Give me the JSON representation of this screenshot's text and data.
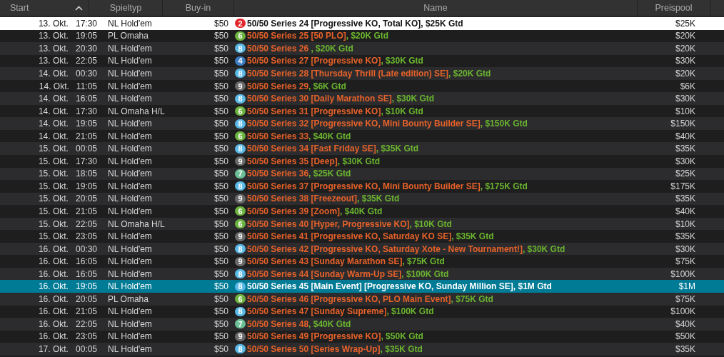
{
  "table": {
    "columns": [
      {
        "label": "Start",
        "sorted": true
      },
      {
        "label": "Spieltyp",
        "sorted": false
      },
      {
        "label": "Buy-in",
        "sorted": false
      },
      {
        "label": "Name",
        "sorted": false
      },
      {
        "label": "Preispool",
        "sorted": false
      }
    ],
    "rows": [
      {
        "date": "13. Okt.",
        "time": "17:30",
        "game": "NL Hold'em",
        "buyin": "$50",
        "badge": {
          "text": "2",
          "color": "#e3262b"
        },
        "title": "50/50 Series 24 [Progressive KO, Total KO]",
        "guarantee": ", $25K Gtd",
        "prize": "$25K",
        "highlighted": true,
        "selected": false
      },
      {
        "date": "13. Okt.",
        "time": "19:05",
        "game": "PL Omaha",
        "buyin": "$50",
        "badge": {
          "text": "6",
          "color": "#6cb33f"
        },
        "title": "50/50 Series 25 [50 PLO]",
        "guarantee": ", $20K Gtd",
        "prize": "$20K",
        "highlighted": false,
        "selected": false
      },
      {
        "date": "13. Okt.",
        "time": "20:30",
        "game": "NL Hold'em",
        "buyin": "$50",
        "badge": {
          "text": "8",
          "color": "#5ab9e6"
        },
        "title": "50/50 Series 26 ",
        "guarantee": ", $20K Gtd",
        "prize": "$20K",
        "highlighted": false,
        "selected": false
      },
      {
        "date": "13. Okt.",
        "time": "22:05",
        "game": "NL Hold'em",
        "buyin": "$50",
        "badge": {
          "text": "4",
          "color": "#3c7cc2"
        },
        "title": "50/50 Series 27 [Progressive KO]",
        "guarantee": ", $30K Gtd",
        "prize": "$30K",
        "highlighted": false,
        "selected": false
      },
      {
        "date": "14. Okt.",
        "time": "00:30",
        "game": "NL Hold'em",
        "buyin": "$50",
        "badge": {
          "text": "8",
          "color": "#5ab9e6"
        },
        "title": "50/50 Series 28 [Thursday Thrill (Late edition) SE]",
        "guarantee": ", $20K Gtd",
        "prize": "$20K",
        "highlighted": false,
        "selected": false
      },
      {
        "date": "14. Okt.",
        "time": "11:05",
        "game": "NL Hold'em",
        "buyin": "$50",
        "badge": {
          "text": "9",
          "color": "#6a6a6a"
        },
        "title": "50/50 Series 29",
        "guarantee": ", $6K Gtd",
        "prize": "$6K",
        "highlighted": false,
        "selected": false
      },
      {
        "date": "14. Okt.",
        "time": "16:05",
        "game": "NL Hold'em",
        "buyin": "$50",
        "badge": {
          "text": "8",
          "color": "#5ab9e6"
        },
        "title": "50/50 Series 30 [Daily Marathon SE]",
        "guarantee": ", $30K Gtd",
        "prize": "$30K",
        "highlighted": false,
        "selected": false
      },
      {
        "date": "14. Okt.",
        "time": "17:30",
        "game": "NL Omaha H/L",
        "buyin": "$50",
        "badge": {
          "text": "6",
          "color": "#6cb33f"
        },
        "title": "50/50 Series 31 [Progressive KO]",
        "guarantee": ", $10K Gtd",
        "prize": "$10K",
        "highlighted": false,
        "selected": false
      },
      {
        "date": "14. Okt.",
        "time": "19:05",
        "game": "NL Hold'em",
        "buyin": "$50",
        "badge": {
          "text": "8",
          "color": "#5ab9e6"
        },
        "title": "50/50 Series 32 [Progressive KO, Mini Bounty Builder SE]",
        "guarantee": ", $150K Gtd",
        "prize": "$150K",
        "highlighted": false,
        "selected": false
      },
      {
        "date": "14. Okt.",
        "time": "21:05",
        "game": "NL Hold'em",
        "buyin": "$50",
        "badge": {
          "text": "6",
          "color": "#6cb33f"
        },
        "title": "50/50 Series 33",
        "guarantee": ", $40K Gtd",
        "prize": "$40K",
        "highlighted": false,
        "selected": false
      },
      {
        "date": "15. Okt.",
        "time": "00:05",
        "game": "NL Hold'em",
        "buyin": "$50",
        "badge": {
          "text": "8",
          "color": "#5ab9e6"
        },
        "title": "50/50 Series 34 [Fast Friday SE]",
        "guarantee": ", $35K Gtd",
        "prize": "$35K",
        "highlighted": false,
        "selected": false
      },
      {
        "date": "15. Okt.",
        "time": "17:30",
        "game": "NL Hold'em",
        "buyin": "$50",
        "badge": {
          "text": "9",
          "color": "#6a6a6a"
        },
        "title": "50/50 Series 35 [Deep]",
        "guarantee": ", $30K Gtd",
        "prize": "$30K",
        "highlighted": false,
        "selected": false
      },
      {
        "date": "15. Okt.",
        "time": "18:05",
        "game": "NL Hold'em",
        "buyin": "$50",
        "badge": {
          "text": "7",
          "color": "#6dbf97"
        },
        "title": "50/50 Series 36",
        "guarantee": ", $25K Gtd",
        "prize": "$25K",
        "highlighted": false,
        "selected": false
      },
      {
        "date": "15. Okt.",
        "time": "19:05",
        "game": "NL Hold'em",
        "buyin": "$50",
        "badge": {
          "text": "8",
          "color": "#5ab9e6"
        },
        "title": "50/50 Series 37 [Progressive KO, Mini Bounty Builder SE]",
        "guarantee": ", $175K Gtd",
        "prize": "$175K",
        "highlighted": false,
        "selected": false
      },
      {
        "date": "15. Okt.",
        "time": "20:05",
        "game": "NL Hold'em",
        "buyin": "$50",
        "badge": {
          "text": "9",
          "color": "#6a6a6a"
        },
        "title": "50/50 Series 38 [Freezeout]",
        "guarantee": ", $35K Gtd",
        "prize": "$35K",
        "highlighted": false,
        "selected": false
      },
      {
        "date": "15. Okt.",
        "time": "21:05",
        "game": "NL Hold'em",
        "buyin": "$50",
        "badge": {
          "text": "6",
          "color": "#6cb33f"
        },
        "title": "50/50 Series 39 [Zoom]",
        "guarantee": ", $40K Gtd",
        "prize": "$40K",
        "highlighted": false,
        "selected": false
      },
      {
        "date": "15. Okt.",
        "time": "22:05",
        "game": "NL Omaha H/L",
        "buyin": "$50",
        "badge": {
          "text": "6",
          "color": "#6cb33f"
        },
        "title": "50/50 Series 40 [Hyper, Progressive KO]",
        "guarantee": ", $10K Gtd",
        "prize": "$10K",
        "highlighted": false,
        "selected": false
      },
      {
        "date": "15. Okt.",
        "time": "23:05",
        "game": "NL Hold'em",
        "buyin": "$50",
        "badge": {
          "text": "9",
          "color": "#6a6a6a"
        },
        "title": "50/50 Series 41 [Progressive KO, Saturday KO SE]",
        "guarantee": ", $35K Gtd",
        "prize": "$35K",
        "highlighted": false,
        "selected": false
      },
      {
        "date": "16. Okt.",
        "time": "00:30",
        "game": "NL Hold'em",
        "buyin": "$50",
        "badge": {
          "text": "8",
          "color": "#5ab9e6"
        },
        "title": "50/50 Series 42 [Progressive KO, Saturday Xote - New Tournament!]",
        "guarantee": ", $30K Gtd",
        "prize": "$30K",
        "highlighted": false,
        "selected": false
      },
      {
        "date": "16. Okt.",
        "time": "16:05",
        "game": "NL Hold'em",
        "buyin": "$50",
        "badge": {
          "text": "9",
          "color": "#6a6a6a"
        },
        "title": "50/50 Series 43 [Sunday Marathon SE]",
        "guarantee": ", $75K Gtd",
        "prize": "$75K",
        "highlighted": false,
        "selected": false
      },
      {
        "date": "16. Okt.",
        "time": "16:05",
        "game": "NL Hold'em",
        "buyin": "$50",
        "badge": {
          "text": "8",
          "color": "#5ab9e6"
        },
        "title": "50/50 Series 44 [Sunday Warm-Up SE]",
        "guarantee": ", $100K Gtd",
        "prize": "$100K",
        "highlighted": false,
        "selected": false
      },
      {
        "date": "16. Okt.",
        "time": "19:05",
        "game": "NL Hold'em",
        "buyin": "$50",
        "badge": {
          "text": "8",
          "color": "#5ab9e6"
        },
        "title": "50/50 Series 45 [Main Event] [Progressive KO, Sunday Million SE]",
        "guarantee": ", $1M Gtd",
        "prize": "$1M",
        "highlighted": false,
        "selected": true
      },
      {
        "date": "16. Okt.",
        "time": "20:05",
        "game": "PL Omaha",
        "buyin": "$50",
        "badge": {
          "text": "6",
          "color": "#6cb33f"
        },
        "title": "50/50 Series 46 [Progressive KO, PLO Main Event]",
        "guarantee": ", $75K Gtd",
        "prize": "$75K",
        "highlighted": false,
        "selected": false
      },
      {
        "date": "16. Okt.",
        "time": "21:05",
        "game": "NL Hold'em",
        "buyin": "$50",
        "badge": {
          "text": "8",
          "color": "#5ab9e6"
        },
        "title": "50/50 Series 47 [Sunday Supreme]",
        "guarantee": ", $100K Gtd",
        "prize": "$100K",
        "highlighted": false,
        "selected": false
      },
      {
        "date": "16. Okt.",
        "time": "22:05",
        "game": "NL Hold'em",
        "buyin": "$50",
        "badge": {
          "text": "7",
          "color": "#6dbf97"
        },
        "title": "50/50 Series 48",
        "guarantee": ", $40K Gtd",
        "prize": "$40K",
        "highlighted": false,
        "selected": false
      },
      {
        "date": "16. Okt.",
        "time": "23:05",
        "game": "NL Hold'em",
        "buyin": "$50",
        "badge": {
          "text": "9",
          "color": "#6a6a6a"
        },
        "title": "50/50 Series 49 [Progressive KO]",
        "guarantee": ", $50K Gtd",
        "prize": "$50K",
        "highlighted": false,
        "selected": false
      },
      {
        "date": "17. Okt.",
        "time": "00:05",
        "game": "NL Hold'em",
        "buyin": "$50",
        "badge": {
          "text": "8",
          "color": "#5ab9e6"
        },
        "title": "50/50 Series 50 [Series Wrap-Up]",
        "guarantee": ", $35K Gtd",
        "prize": "$35K",
        "highlighted": false,
        "selected": false
      }
    ]
  }
}
